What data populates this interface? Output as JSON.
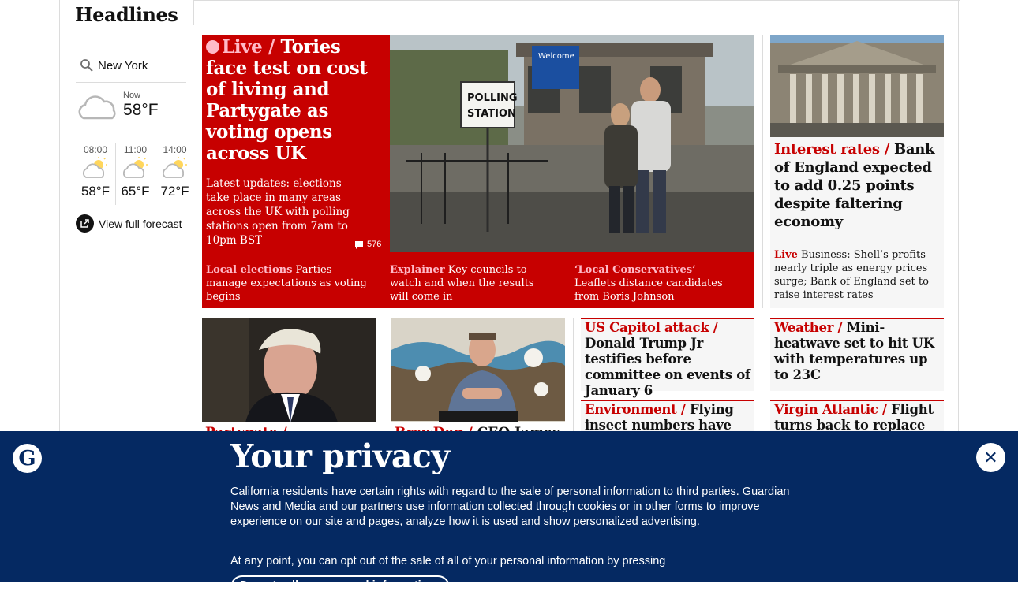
{
  "header": {
    "title": "Headlines"
  },
  "weather": {
    "location": "New York",
    "now_label": "Now",
    "now_temp": "58°F",
    "hours": [
      {
        "time": "08:00",
        "temp": "58°F"
      },
      {
        "time": "11:00",
        "temp": "65°F"
      },
      {
        "time": "14:00",
        "temp": "72°F"
      }
    ],
    "forecast_link": "View full forecast"
  },
  "lead": {
    "kicker": "Live /",
    "headline": "Tories face test on cost of living and Partygate as voting opens across UK",
    "standfirst": "Latest updates: elections take place in many areas across the UK with polling stations open from 7am to 10pm BST",
    "comments": "576",
    "subs": [
      {
        "kicker": "Local elections",
        "text": "Parties manage expectations as voting begins"
      },
      {
        "kicker": "Explainer",
        "text": "Key councils to watch and when the results will come in"
      },
      {
        "kicker": "‘Local Conservatives’",
        "text": "Leaflets distance candidates from Boris Johnson"
      }
    ],
    "image_sign": {
      "welcome": "Welcome",
      "polling": "POLLING",
      "station": "STATION"
    }
  },
  "boe": {
    "kicker": "Interest rates /",
    "headline": "Bank of England expected to add 0.25 points despite faltering economy",
    "live": "Live",
    "standfirst": "Business: Shell’s profits nearly triple as energy prices surge; Bank of England set to raise interest rates"
  },
  "cards": [
    {
      "kicker": "US Capitol attack /",
      "headline": "Donald Trump Jr testifies before committee on events of January 6"
    },
    {
      "kicker": "Weather /",
      "headline": "Mini-heatwave set to hit UK with temperatures up to 23C"
    },
    {
      "kicker": "Environment /",
      "headline": "Flying insect numbers have"
    },
    {
      "kicker": "Virgin Atlantic /",
      "headline": "Flight turns back to replace pilot"
    }
  ],
  "below": [
    {
      "kicker": "Partygate /",
      "headline": ""
    },
    {
      "kicker": "BrewDog /",
      "headline": "CEO James"
    }
  ],
  "privacy": {
    "logo": "G",
    "title": "Your privacy",
    "text": "California residents have certain rights with regard to the sale of personal information to third parties. Guardian News and Media and our partners use information collected through cookies or in other forms to improve experience on our site and pages, analyze how it is used and show personalized advertising.",
    "text2": "At any point, you can opt out of the sale of all of your personal information by pressing",
    "button": "Do not sell my personal information",
    "close": "✕"
  }
}
